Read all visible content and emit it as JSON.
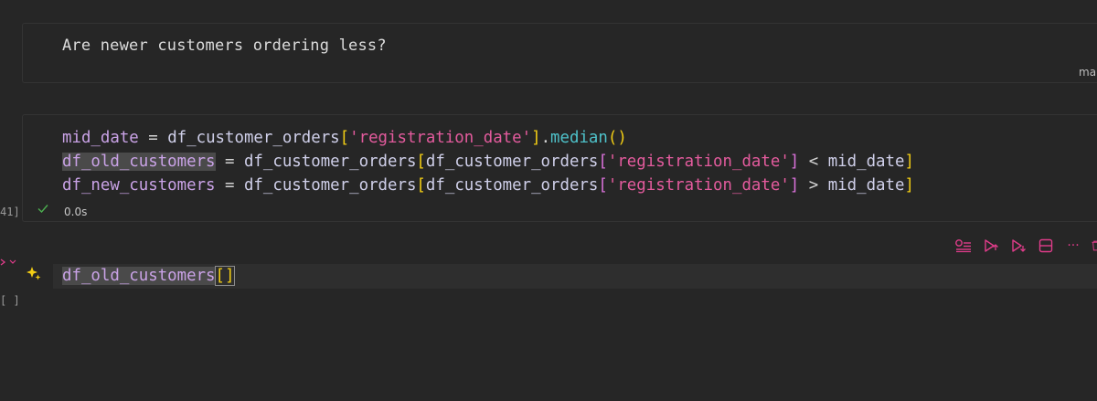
{
  "markdown_cell": {
    "text": "Are newer customers ordering less?",
    "lang_tag": "mar"
  },
  "code_cell": {
    "line1": {
      "var": "mid_date",
      "eq": " = ",
      "df": "df_customer_orders",
      "open": "[",
      "str": "'registration_date'",
      "close": "]",
      "dot": ".",
      "method": "median",
      "paren": "()"
    },
    "line2": {
      "var": "df_old_customers",
      "eq": " = ",
      "df": "df_customer_orders",
      "open": "[",
      "df2": "df_customer_orders",
      "open2": "[",
      "str": "'registration_date'",
      "close2": "]",
      "op": " < ",
      "ref": "mid_date",
      "close": "]"
    },
    "line3": {
      "var": "df_new_customers",
      "eq": " = ",
      "df": "df_customer_orders",
      "open": "[",
      "df2": "df_customer_orders",
      "open2": "[",
      "str": "'registration_date'",
      "close2": "]",
      "op": " > ",
      "ref": "mid_date",
      "close": "]"
    },
    "exec_count": "41]",
    "status_time": "0.0s"
  },
  "active_cell": {
    "var": "df_old_customers",
    "brackets": "[]",
    "exec_count": "[ ]"
  },
  "toolbar": {
    "more_label": "···"
  },
  "colors": {
    "background": "#262626",
    "accent_pink": "#e03c8a",
    "check_green": "#4caf50"
  },
  "icons": [
    "run-by-line-icon",
    "execute-above-icon",
    "execute-below-icon",
    "split-cell-icon",
    "more-icon",
    "delete-icon",
    "sparkle-icon",
    "check-icon",
    "run-arrow-icon"
  ]
}
